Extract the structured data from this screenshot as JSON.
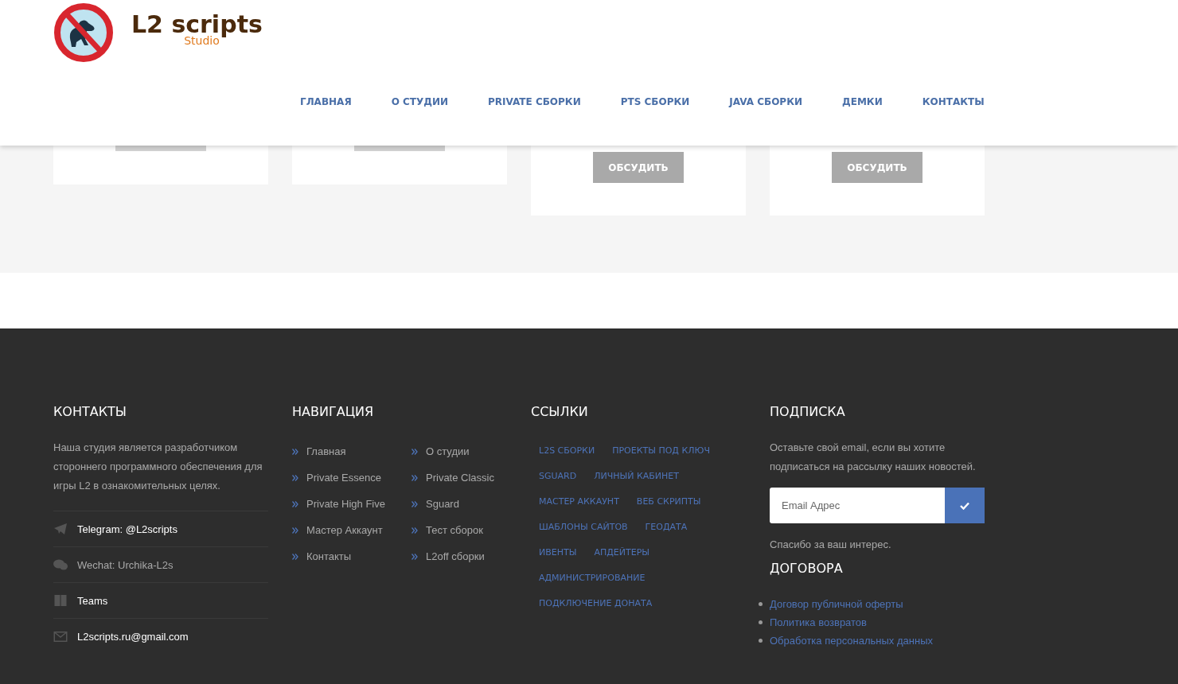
{
  "header": {
    "logo_title": "L2 scripts",
    "logo_subtitle": "Studio",
    "nav": [
      "ГЛАВНАЯ",
      "О СТУДИИ",
      "PRIVATE СБОРКИ",
      "PTS СБОРКИ",
      "JAVA СБОРКИ",
      "ДЕМКИ",
      "КОНТАКТЫ"
    ]
  },
  "cards": [
    {
      "kind": "cut"
    },
    {
      "kind": "cut"
    },
    {
      "kind": "full",
      "button": "ОБСУДИТЬ"
    },
    {
      "kind": "full",
      "button": "ОБСУДИТЬ"
    }
  ],
  "footer": {
    "contacts": {
      "title": "КОНТАКТЫ",
      "text": "Наша студия является разработчиком стороннего программного обеспечения для игры L2 в ознакомительных целях.",
      "items": [
        {
          "text": "Telegram: @L2scripts",
          "kind": "link"
        },
        {
          "text": "Wechat: Urchika-L2s",
          "kind": "text"
        },
        {
          "text": "Teams",
          "kind": "link"
        },
        {
          "text": "L2scripts.ru@gmail.com",
          "kind": "link"
        }
      ]
    },
    "navigation": {
      "title": "НАВИГАЦИЯ",
      "items": [
        "Главная",
        "О студии",
        "Private Essence",
        "Private Classic",
        "Private High Five",
        "Sguard",
        "Мастер Аккаунт",
        "Тест сборок",
        "Контакты",
        "L2off сборки"
      ]
    },
    "links": {
      "title": "ССЫЛКИ",
      "rows": [
        [
          "L2S СБОРКИ",
          "ПРОЕКТЫ ПОД КЛЮЧ"
        ],
        [
          "SGUARD",
          "ЛИЧНЫЙ КАБИНЕТ"
        ],
        [
          "МАСТЕР АККАУНТ",
          "ВЕБ СКРИПТЫ"
        ],
        [
          "ШАБЛОНЫ САЙТОВ",
          "ГЕОДАТА"
        ],
        [
          "ИВЕНТЫ",
          "АПДЕЙТЕРЫ"
        ],
        [
          "АДМИНИСТРИРОВАНИЕ"
        ],
        [
          "ПОДКЛЮЧЕНИЕ ДОНАТА"
        ]
      ]
    },
    "subscribe": {
      "title": "ПОДПИСКА",
      "text": "Оставьте свой email, если вы хотите подписаться на рассылку наших новостей.",
      "placeholder": "Email Адрес",
      "thanks": "Спасибо за ваш интерес."
    },
    "contracts": {
      "title": "ДОГОВОРА",
      "items": [
        "Договор публичной оферты",
        "Политика возвратов",
        "Обработка персональных данных"
      ]
    }
  }
}
